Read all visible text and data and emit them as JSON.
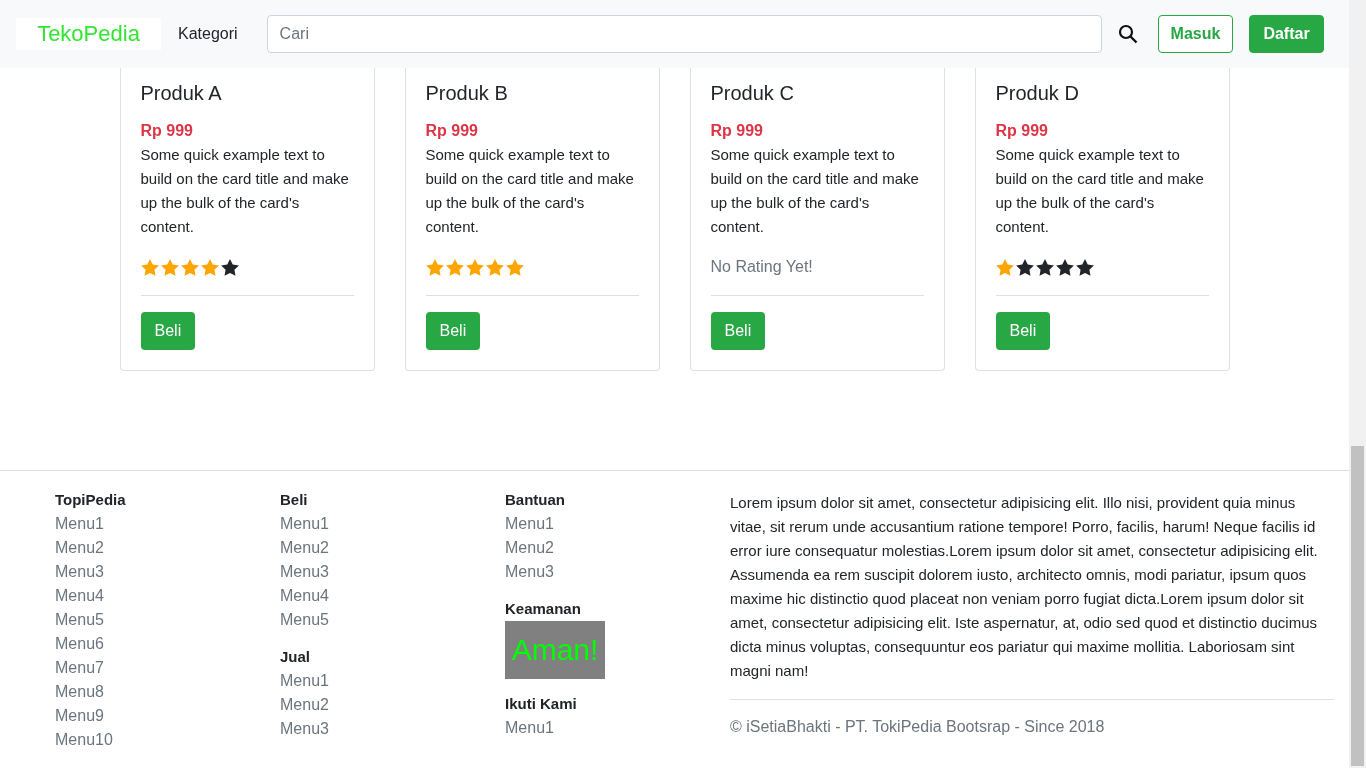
{
  "navbar": {
    "brand": "TekoPedia",
    "category": "Kategori",
    "search": {
      "placeholder": "Cari"
    },
    "login": "Masuk",
    "register": "Daftar"
  },
  "products": [
    {
      "title": "Produk A",
      "price": "Rp 999",
      "text": "Some quick example text to build on the card title and make up the bulk of the card's content.",
      "stars": 4,
      "button": "Beli"
    },
    {
      "title": "Produk B",
      "price": "Rp 999",
      "text": "Some quick example text to build on the card title and make up the bulk of the card's content.",
      "stars": 5,
      "button": "Beli"
    },
    {
      "title": "Produk C",
      "price": "Rp 999",
      "text": "Some quick example text to build on the card title and make up the bulk of the card's content.",
      "rating_note": "No Rating Yet!",
      "button": "Beli"
    },
    {
      "title": "Produk D",
      "price": "Rp 999",
      "text": "Some quick example text to build on the card title and make up the bulk of the card's content.",
      "stars": 1,
      "button": "Beli"
    }
  ],
  "footer": {
    "columns": [
      [
        {
          "title": "TopiPedia",
          "items": [
            "Menu1",
            "Menu2",
            "Menu3",
            "Menu4",
            "Menu5",
            "Menu6",
            "Menu7",
            "Menu8",
            "Menu9",
            "Menu10"
          ]
        }
      ],
      [
        {
          "title": "Beli",
          "items": [
            "Menu1",
            "Menu2",
            "Menu3",
            "Menu4",
            "Menu5"
          ]
        },
        {
          "title": "Jual",
          "items": [
            "Menu1",
            "Menu2",
            "Menu3"
          ]
        }
      ],
      [
        {
          "title": "Bantuan",
          "items": [
            "Menu1",
            "Menu2",
            "Menu3"
          ]
        },
        {
          "title": "Keamanan",
          "badge": "Aman!"
        },
        {
          "title": "Ikuti Kami",
          "items": [
            "Menu1"
          ]
        }
      ]
    ],
    "about": "Lorem ipsum dolor sit amet, consectetur adipisicing elit. Illo nisi, provident quia minus vitae, sit rerum unde accusantium ratione tempore! Porro, facilis, harum! Neque facilis id error iure consequatur molestias.Lorem ipsum dolor sit amet, consectetur adipisicing elit. Assumenda ea rem suscipit dolorem iusto, architecto omnis, modi pariatur, ipsum quos maxime hic distinctio quod placeat non veniam porro fugiat dicta.Lorem ipsum dolor sit amet, consectetur adipisicing elit. Iste aspernatur, at, odio sed quod et distinctio ducimus dicta minus voluptas, consequuntur eos pariatur qui maxime mollitia. Laboriosam sint magni nam!",
    "copyright": "© iSetiaBhakti - PT. TokiPedia Bootsrap - Since 2018"
  }
}
